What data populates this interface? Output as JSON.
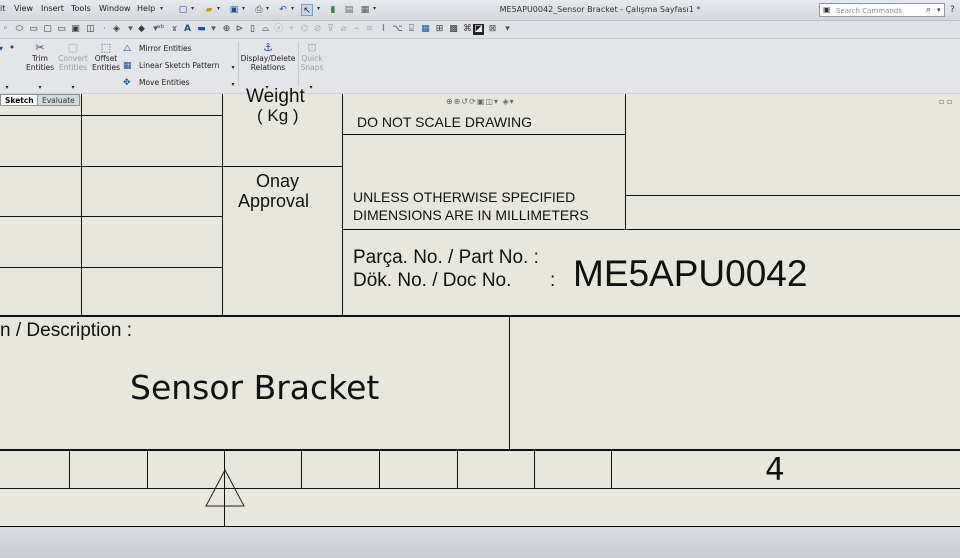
{
  "menubar": {
    "menus": [
      "it",
      "View",
      "Insert",
      "Tools",
      "Window",
      "Help"
    ],
    "title": "ME5APU0042_Sensor Bracket - Çalışma Sayfası1 *",
    "search_placeholder": "Search Commands"
  },
  "ribbon": {
    "trim_label_1": "Trim",
    "trim_label_2": "Entities",
    "convert_label_1": "Convert",
    "convert_label_2": "Entities",
    "offset_label_1": "Offset",
    "offset_label_2": "Entities",
    "mirror_label": "Mirror Entities",
    "pattern_label": "Linear Sketch Pattern",
    "move_label": "Move Entities",
    "display_label_1": "Display/Delete",
    "display_label_2": "Relations",
    "snaps_label_1": "Quick",
    "snaps_label_2": "Snaps"
  },
  "tabs": {
    "sketch": "Sketch",
    "evaluate": "Evaluate"
  },
  "title_block": {
    "weight_label": "Weight",
    "weight_unit": "( Kg )",
    "do_not_scale": "DO NOT SCALE DRAWING",
    "approval_tr": "Onay",
    "approval_en": "Approval",
    "unless_line1": "UNLESS OTHERWISE SPECIFIED",
    "unless_line2": "DIMENSIONS ARE IN MILLIMETERS",
    "part_no_label": "Parça. No. / Part No. :",
    "doc_no_label": "Dök. No. / Doc No.",
    "doc_no_colon": ":",
    "part_number": "ME5APU0042",
    "description_label": "n / Description :",
    "description_value": "Sensor Bracket",
    "revision": "4"
  }
}
